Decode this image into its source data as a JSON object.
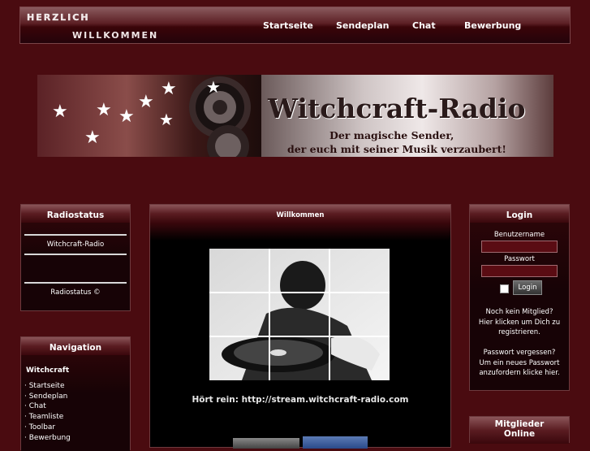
{
  "header": {
    "welcome_line1": "Herzlich",
    "welcome_line2": "Willkommen",
    "nav": [
      "Startseite",
      "Sendeplan",
      "Chat",
      "Bewerbung"
    ]
  },
  "banner": {
    "title": "Witchcraft-Radio",
    "subtitle_line1": "Der magische Sender,",
    "subtitle_line2": "der euch mit seiner Musik verzaubert!"
  },
  "radiostatus": {
    "title": "Radiostatus",
    "station": "Witchcraft-Radio",
    "footer": "Radiostatus ©"
  },
  "navigation": {
    "title": "Navigation",
    "section": "Witchcraft",
    "items": [
      "· Startseite",
      "· Sendeplan",
      "· Chat",
      "· Teamliste",
      "· Toolbar",
      "· Bewerbung"
    ]
  },
  "main": {
    "title": "Willkommen",
    "stream_text": "Hört rein: http://stream.witchcraft-radio.com"
  },
  "login": {
    "title": "Login",
    "username_label": "Benutzername",
    "password_label": "Passwort",
    "button": "Login",
    "register_text_1": "Noch kein Mitglied?",
    "register_text_2": "Hier klicken um Dich zu",
    "register_text_3": "registrieren.",
    "forgot_text_1": "Passwort vergessen?",
    "forgot_text_2": "Um ein neues Passwort",
    "forgot_text_3": "anzufordern klicke hier."
  },
  "members": {
    "title_line1": "Mitglieder",
    "title_line2": "Online"
  }
}
